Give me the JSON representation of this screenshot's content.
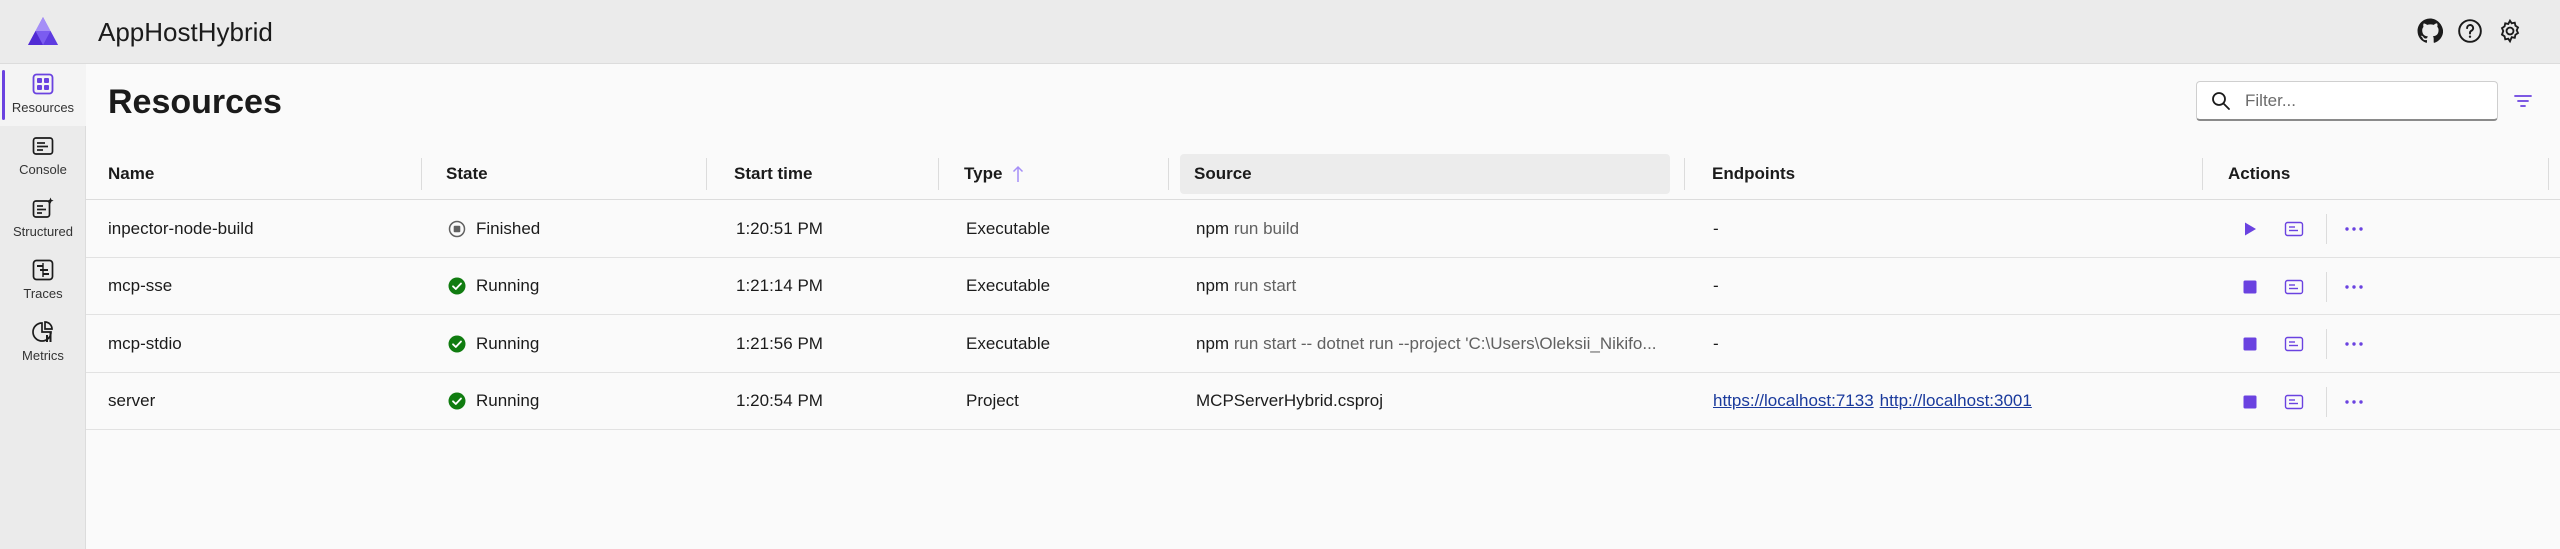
{
  "header": {
    "app_title": "AppHostHybrid",
    "icons": [
      "github-icon",
      "help-icon",
      "settings-icon"
    ]
  },
  "sidebar": {
    "items": [
      {
        "label": "Resources",
        "icon": "resources-grid-icon",
        "active": true
      },
      {
        "label": "Console",
        "icon": "console-icon",
        "active": false
      },
      {
        "label": "Structured",
        "icon": "structured-logs-icon",
        "active": false
      },
      {
        "label": "Traces",
        "icon": "traces-icon",
        "active": false
      },
      {
        "label": "Metrics",
        "icon": "metrics-icon",
        "active": false
      }
    ]
  },
  "main": {
    "title": "Resources",
    "filter": {
      "placeholder": "Filter...",
      "value": ""
    },
    "columns": [
      "Name",
      "State",
      "Start time",
      "Type",
      "Source",
      "Endpoints",
      "Actions"
    ],
    "sort": {
      "column": "Type",
      "direction": "ascending"
    },
    "rows": [
      {
        "name": "inpector-node-build",
        "state": "Finished",
        "state_kind": "finished",
        "start_time": "1:20:51 PM",
        "type": "Executable",
        "source_cmd": "npm",
        "source_args": "run build",
        "endpoints": [
          "-"
        ],
        "primary_action": "start"
      },
      {
        "name": "mcp-sse",
        "state": "Running",
        "state_kind": "running",
        "start_time": "1:21:14 PM",
        "type": "Executable",
        "source_cmd": "npm",
        "source_args": "run start",
        "endpoints": [
          "-"
        ],
        "primary_action": "stop"
      },
      {
        "name": "mcp-stdio",
        "state": "Running",
        "state_kind": "running",
        "start_time": "1:21:56 PM",
        "type": "Executable",
        "source_cmd": "npm",
        "source_args": "run start -- dotnet run --project 'C:\\Users\\Oleksii_Nikifo...",
        "endpoints": [
          "-"
        ],
        "primary_action": "stop"
      },
      {
        "name": "server",
        "state": "Running",
        "state_kind": "running",
        "start_time": "1:20:54 PM",
        "type": "Project",
        "source_cmd": "MCPServerHybrid.csproj",
        "source_args": "",
        "endpoints": [
          "https://localhost:7133",
          "http://localhost:3001"
        ],
        "primary_action": "stop"
      }
    ]
  },
  "colors": {
    "accent": "#6a42e0",
    "running": "#107c10",
    "finished": "#616161",
    "link": "#1a3a9c"
  }
}
